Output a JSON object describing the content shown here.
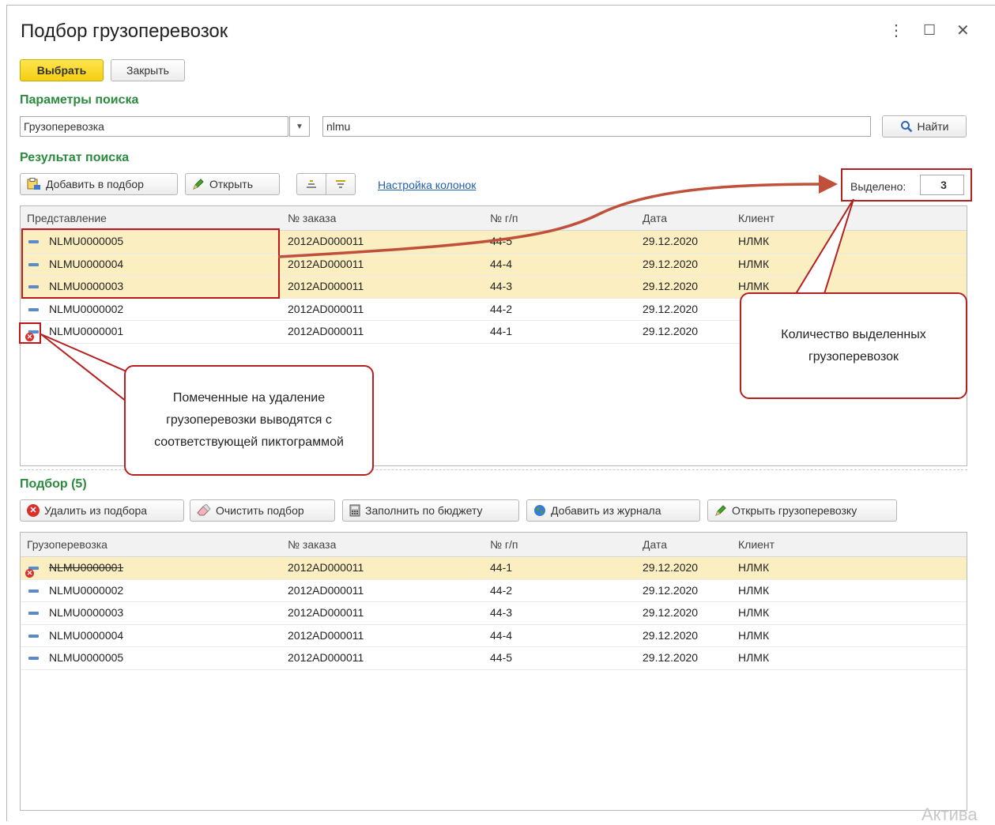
{
  "window": {
    "title": "Подбор грузоперевозок",
    "controls": {
      "more_icon": "more-vertical-icon",
      "maximize_icon": "maximize-icon",
      "close_icon": "close-icon"
    }
  },
  "toolbar": {
    "select_label": "Выбрать",
    "close_label": "Закрыть"
  },
  "search": {
    "section_title": "Параметры поиска",
    "type_value": "Грузоперевозка",
    "query_value": "nlmu",
    "find_label": "Найти"
  },
  "results": {
    "section_title": "Результат поиска",
    "add_label": "Добавить в подбор",
    "open_label": "Открыть",
    "columns_link": "Настройка колонок",
    "selected_label": "Выделено:",
    "selected_count": "3",
    "headers": [
      "Представление",
      "№ заказа",
      "№ г/п",
      "Дата",
      "Клиент"
    ],
    "rows": [
      {
        "name": "NLMU0000005",
        "order": "2012AD000011",
        "gp": "44-5",
        "date": "29.12.2020",
        "client": "НЛМК",
        "selected": true,
        "deleted": false
      },
      {
        "name": "NLMU0000004",
        "order": "2012AD000011",
        "gp": "44-4",
        "date": "29.12.2020",
        "client": "НЛМК",
        "selected": true,
        "deleted": false
      },
      {
        "name": "NLMU0000003",
        "order": "2012AD000011",
        "gp": "44-3",
        "date": "29.12.2020",
        "client": "НЛМК",
        "selected": true,
        "deleted": false
      },
      {
        "name": "NLMU0000002",
        "order": "2012AD000011",
        "gp": "44-2",
        "date": "29.12.2020",
        "client": "",
        "selected": false,
        "deleted": false
      },
      {
        "name": "NLMU0000001",
        "order": "2012AD000011",
        "gp": "44-1",
        "date": "29.12.2020",
        "client": "",
        "selected": false,
        "deleted": true
      }
    ]
  },
  "callouts": {
    "deleted_note": "Помеченные на удаление\nгрузоперевозки выводятся с\nсоответствующей пиктограммой",
    "count_note": "Количество выделенных\nгрузоперевозок"
  },
  "selection": {
    "section_title": "Подбор (5)",
    "remove_label": "Удалить из подбора",
    "clear_label": "Очистить подбор",
    "fill_label": "Заполнить по бюджету",
    "add_journal_label": "Добавить из журнала",
    "open_label": "Открыть грузоперевозку",
    "headers": [
      "Грузоперевозка",
      "№ заказа",
      "№ г/п",
      "Дата",
      "Клиент"
    ],
    "rows": [
      {
        "name": "NLMU0000001",
        "order": "2012AD000011",
        "gp": "44-1",
        "date": "29.12.2020",
        "client": "НЛМК",
        "selected": true,
        "deleted": true
      },
      {
        "name": "NLMU0000002",
        "order": "2012AD000011",
        "gp": "44-2",
        "date": "29.12.2020",
        "client": "НЛМК",
        "selected": false,
        "deleted": false
      },
      {
        "name": "NLMU0000003",
        "order": "2012AD000011",
        "gp": "44-3",
        "date": "29.12.2020",
        "client": "НЛМК",
        "selected": false,
        "deleted": false
      },
      {
        "name": "NLMU0000004",
        "order": "2012AD000011",
        "gp": "44-4",
        "date": "29.12.2020",
        "client": "НЛМК",
        "selected": false,
        "deleted": false
      },
      {
        "name": "NLMU0000005",
        "order": "2012AD000011",
        "gp": "44-5",
        "date": "29.12.2020",
        "client": "НЛМК",
        "selected": false,
        "deleted": false
      }
    ]
  },
  "watermark": "Актива",
  "colors": {
    "accent_yellow": "#f5cf12",
    "section_green": "#2b8a3e",
    "annotation_red": "#b52020",
    "row_selected": "#fbeec0",
    "link_blue": "#1f5fb0"
  }
}
